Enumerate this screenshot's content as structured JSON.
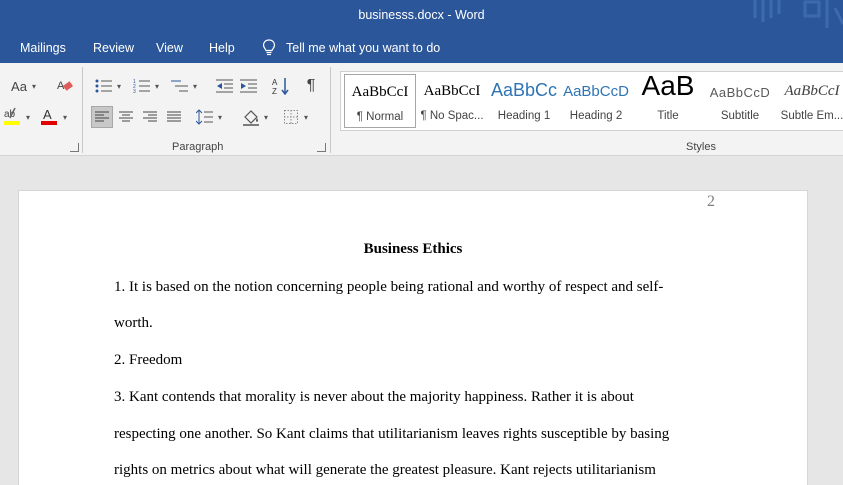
{
  "window": {
    "title": "businesss.docx  -  Word"
  },
  "menu": {
    "tabs": [
      "Mailings",
      "Review",
      "View",
      "Help"
    ],
    "tell_me": "Tell me what you want to do"
  },
  "ribbon": {
    "font": {
      "change_case": "Aa",
      "highlight_label": "ab",
      "font_color_label": "A"
    },
    "paragraph_label": "Paragraph",
    "styles_label": "Styles",
    "styles": [
      {
        "preview": "AaBbCcI",
        "name": "¶ Normal"
      },
      {
        "preview": "AaBbCcI",
        "name": "¶ No Spac..."
      },
      {
        "preview": "AaBbCc",
        "name": "Heading 1"
      },
      {
        "preview": "AaBbCcD",
        "name": "Heading 2"
      },
      {
        "preview": "AaB",
        "name": "Title"
      },
      {
        "preview": "AaBbCcD",
        "name": "Subtitle"
      },
      {
        "preview": "AaBbCcI",
        "name": "Subtle Em..."
      }
    ],
    "colors": {
      "highlight": "#ffff00",
      "font_color": "#e00000"
    }
  },
  "document": {
    "page_number": "2",
    "title": "Business Ethics",
    "lines": [
      "1.  It is based on the notion concerning people being rational and worthy of respect and self-",
      "worth.",
      " 2.  Freedom",
      "3. Kant contends that morality is never about the majority happiness. Rather it is about",
      "respecting one another. So Kant claims that utilitarianism leaves rights susceptible by basing",
      "rights on metrics about what will generate the greatest pleasure. Kant rejects utilitarianism"
    ]
  },
  "colors": {
    "accent": "#2b579a",
    "ribbon_bg": "#f3f3f3",
    "doc_bg": "#e6e6e6"
  }
}
